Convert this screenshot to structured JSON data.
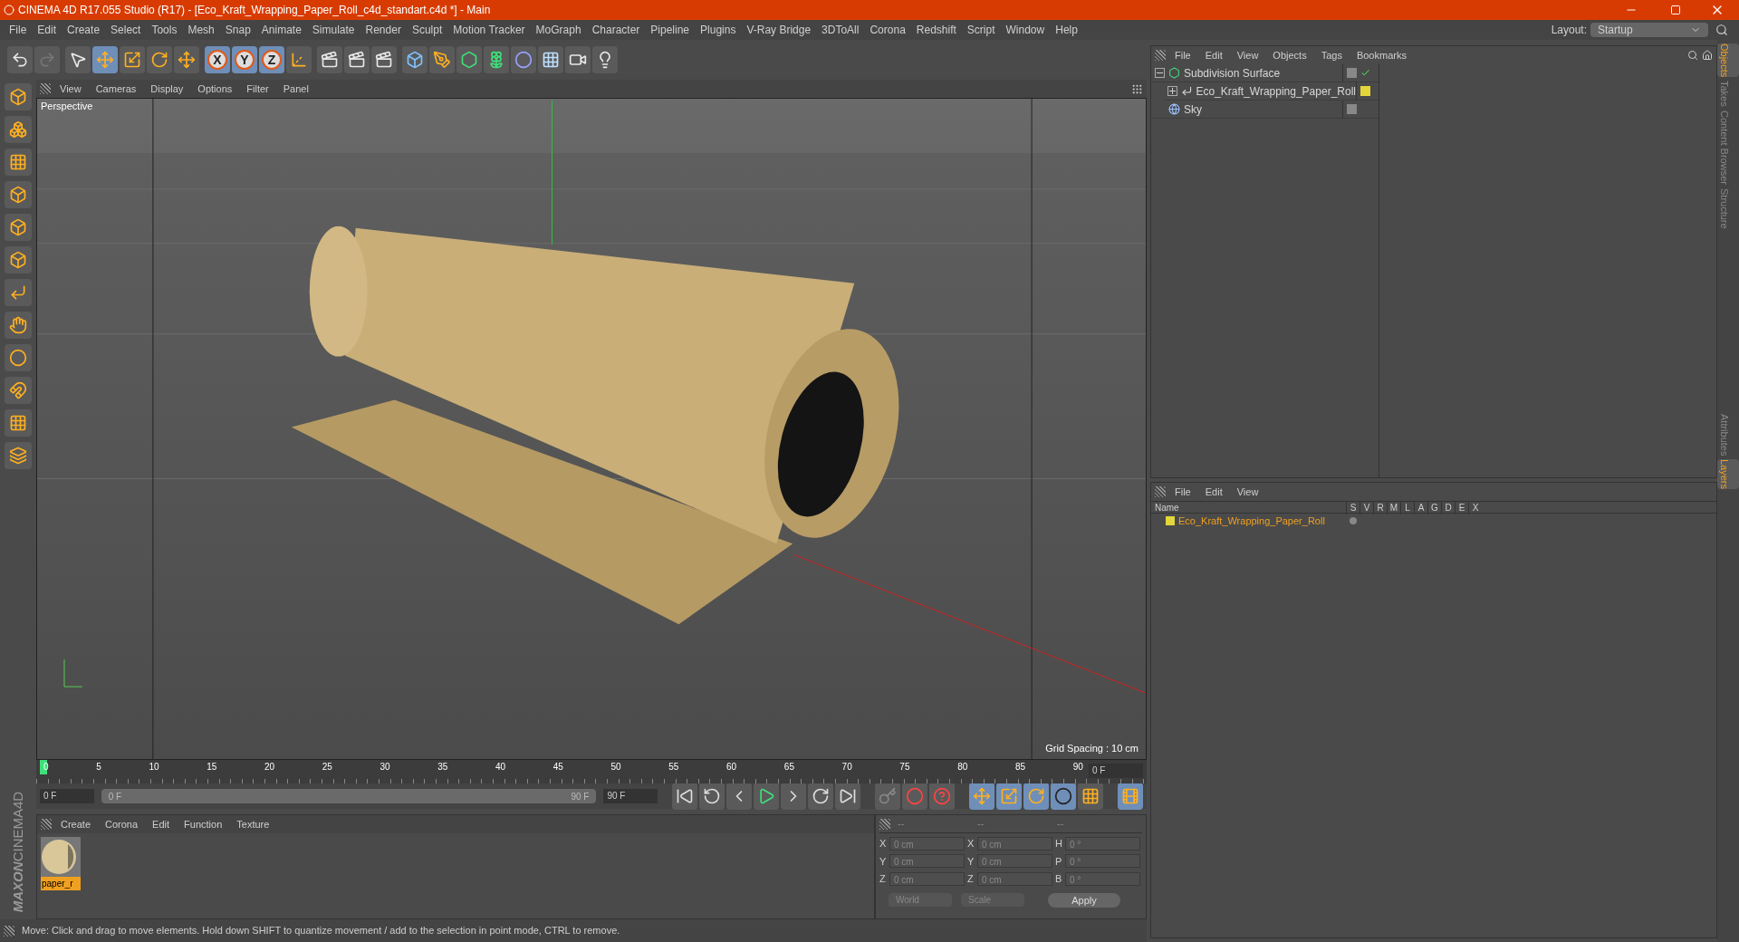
{
  "window": {
    "title": "CINEMA 4D R17.055 Studio (R17) - [Eco_Kraft_Wrapping_Paper_Roll_c4d_standart.c4d *] - Main"
  },
  "menu": [
    "File",
    "Edit",
    "Create",
    "Select",
    "Tools",
    "Mesh",
    "Snap",
    "Animate",
    "Simulate",
    "Render",
    "Sculpt",
    "Motion Tracker",
    "MoGraph",
    "Character",
    "Pipeline",
    "Plugins",
    "V-Ray Bridge",
    "3DToAll",
    "Corona",
    "Redshift",
    "Script",
    "Window",
    "Help"
  ],
  "layout": {
    "label": "Layout:",
    "value": "Startup"
  },
  "axis_buttons": [
    {
      "label": "X",
      "selected": true
    },
    {
      "label": "Y",
      "selected": true
    },
    {
      "label": "Z",
      "selected": true
    }
  ],
  "viewport": {
    "menu": [
      "View",
      "Cameras",
      "Display",
      "Options",
      "Filter",
      "Panel"
    ],
    "camera": "Perspective",
    "grid_spacing": "Grid Spacing : 10 cm"
  },
  "timeline": {
    "ticks": [
      "0",
      "5",
      "10",
      "15",
      "20",
      "25",
      "30",
      "35",
      "40",
      "45",
      "50",
      "55",
      "60",
      "65",
      "70",
      "75",
      "80",
      "85",
      "90"
    ],
    "level": 0,
    "current_frame": "0 F",
    "start_field": "0 F",
    "range": {
      "level": 1,
      "start": "0 F",
      "end": "90 F"
    },
    "end_field": "90 F"
  },
  "materials": {
    "menu": [
      "Create",
      "Corona",
      "Edit",
      "Function",
      "Texture"
    ],
    "items": [
      {
        "name": "paper_r",
        "selected": true
      }
    ]
  },
  "coordinates": {
    "headers": [
      "--",
      "--",
      "--"
    ],
    "rows": [
      {
        "cells": [
          {
            "label": "X",
            "value": "0 cm"
          },
          {
            "label": "X",
            "value": "0 cm"
          },
          {
            "label": "H",
            "value": "0 °"
          }
        ]
      },
      {
        "cells": [
          {
            "label": "Y",
            "value": "0 cm"
          },
          {
            "label": "Y",
            "value": "0 cm"
          },
          {
            "label": "P",
            "value": "0 °"
          }
        ]
      },
      {
        "cells": [
          {
            "label": "Z",
            "value": "0 cm"
          },
          {
            "label": "Z",
            "value": "0 cm"
          },
          {
            "label": "B",
            "value": "0 °"
          }
        ]
      }
    ],
    "dropdowns": [
      "World",
      "Scale"
    ],
    "apply": "Apply"
  },
  "objects": {
    "menu": [
      "File",
      "Edit",
      "View",
      "Objects",
      "Tags",
      "Bookmarks"
    ],
    "tree": [
      {
        "name": "Subdivision Surface",
        "expanded": true,
        "children": [
          {
            "name": "Eco_Kraft_Wrapping_Paper_Roll",
            "expanded": false,
            "color": "#e3d63a"
          }
        ]
      },
      {
        "name": "Sky"
      }
    ]
  },
  "layers": {
    "menu": [
      "File",
      "Edit",
      "View"
    ],
    "columns": [
      "Name",
      "S",
      "V",
      "R",
      "M",
      "L",
      "A",
      "G",
      "D",
      "E",
      "X"
    ],
    "rows": [
      {
        "name": "Eco_Kraft_Wrapping_Paper_Roll",
        "color": "#e3d63a"
      }
    ]
  },
  "side_tabs": [
    {
      "label": "Objects",
      "selected": true
    },
    {
      "label": "Takes",
      "selected": false
    },
    {
      "label": "Content Browser",
      "selected": false
    },
    {
      "label": "Structure",
      "selected": false
    }
  ],
  "side_tabs_lower": [
    {
      "label": "Attributes",
      "selected": false
    },
    {
      "label": "Layers",
      "selected": true
    }
  ],
  "logo": {
    "brand": "MAXON",
    "product": "CINEMA4D"
  },
  "status_bar": "Move: Click and drag to move elements. Hold down SHIFT to quantize movement / add to the selection in point mode, CTRL to remove."
}
